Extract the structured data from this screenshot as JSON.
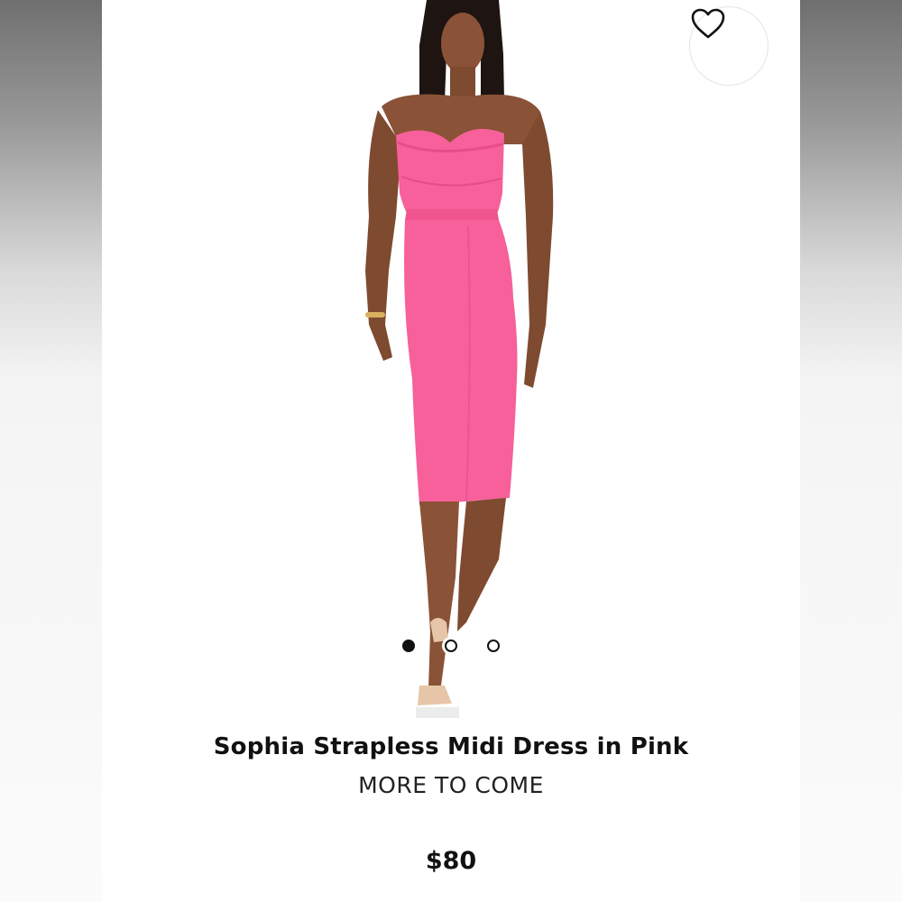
{
  "product": {
    "name": "Sophia Strapless Midi Dress in Pink",
    "brand": "MORE TO COME",
    "price": "$80",
    "favorite_icon": "heart-outline-icon"
  },
  "gallery": {
    "image_count": 3,
    "active_index": 0
  },
  "colors": {
    "dress": "#f7609a",
    "skin": "#8a5236",
    "hair": "#1e1412",
    "dot_active": "#111111"
  }
}
